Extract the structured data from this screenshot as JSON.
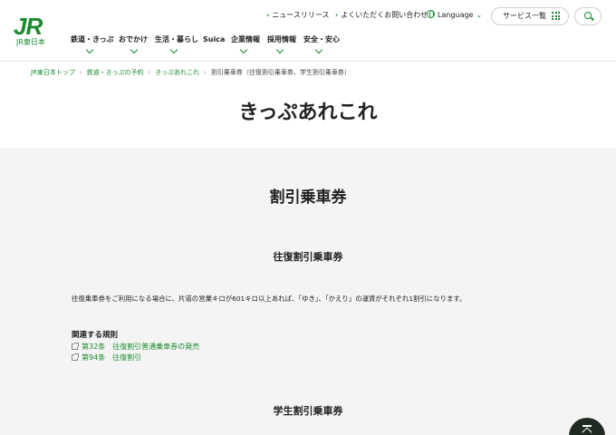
{
  "header": {
    "logo_mark": "JR",
    "logo_sub": "JR東日本",
    "util_links": {
      "news": "ニュースリリース",
      "faq": "よくいただくお問い合わせ",
      "language": "Language"
    },
    "services_label": "サービス一覧",
    "nav": [
      "鉄道・きっぷ",
      "おでかけ",
      "生活・暮らし",
      "Suica",
      "企業情報",
      "採用情報",
      "安全・安心"
    ]
  },
  "breadcrumb": {
    "items": [
      "JR東日本トップ",
      "鉄道・きっぷの予約",
      "きっぷあれこれ"
    ],
    "current": "割引乗車券（往復割引乗車券、学生割引乗車券）"
  },
  "page_title": "きっぷあれこれ",
  "content": {
    "heading": "割引乗車券",
    "section1": {
      "title": "往復割引乗車券",
      "text": "往復乗車券をご利用になる場合に、片道の営業キロが601キロ以上あれば、「ゆき」、「かえり」の運賃がそれぞれ1割引になります。",
      "related_title": "関連する規則",
      "links": [
        "第32条　往復割引普通乗車券の発売",
        "第94条　往復割引"
      ]
    },
    "section2": {
      "title": "学生割引乗車券"
    }
  },
  "icons": {
    "search": "search-icon",
    "grid": "grid-icon",
    "globe": "globe-icon",
    "external": "external-link-icon",
    "pagetop": "arrow-up-icon"
  },
  "colors": {
    "brand": "#1a8a2e",
    "section_bg": "#f4f4f4",
    "pagetop_bg": "#1e2a22"
  }
}
